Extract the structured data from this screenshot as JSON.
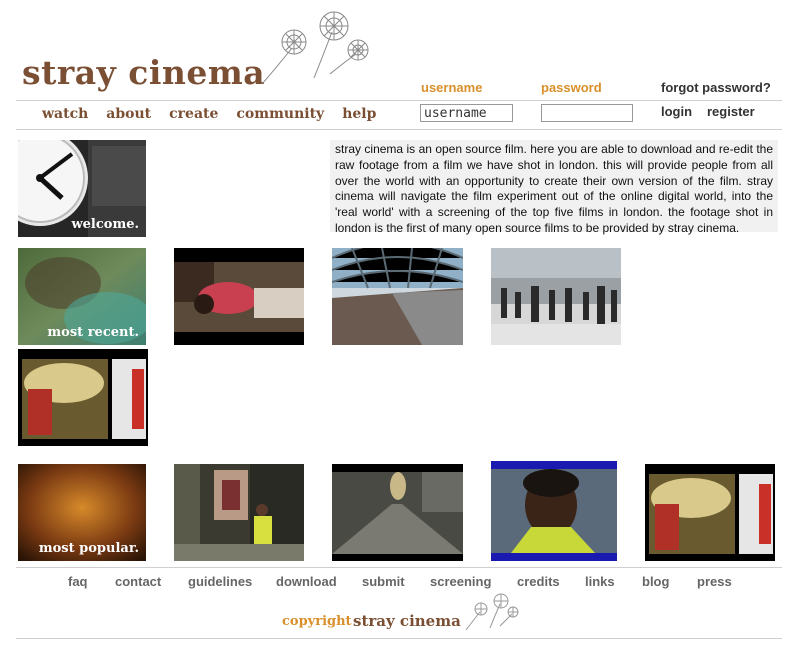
{
  "brand": {
    "name": "stray cinema"
  },
  "nav": {
    "items": [
      {
        "label": "watch"
      },
      {
        "label": "about"
      },
      {
        "label": "create"
      },
      {
        "label": "community"
      },
      {
        "label": "help"
      }
    ]
  },
  "auth": {
    "username_label": "username",
    "password_label": "password",
    "forgot_label": "forgot password?",
    "username_value": "username",
    "password_value": "",
    "login_label": "login",
    "register_label": "register"
  },
  "intro": {
    "text": "stray cinema is an open source film. here you are able to download and re-edit the raw footage from a film we have shot in london. this will provide people from all over the world with an opportunity to create their own version of the film. stray cinema will navigate the film experiment out of the online digital world, into the 'real world' with a screening of the top five films in london. the footage shot in london is the first of many open source films to be provided by stray cinema."
  },
  "sections": {
    "welcome_label": "welcome.",
    "recent_label": "most recent.",
    "popular_label": "most popular."
  },
  "footer": {
    "links": [
      {
        "label": "faq"
      },
      {
        "label": "contact"
      },
      {
        "label": "guidelines"
      },
      {
        "label": "download"
      },
      {
        "label": "submit"
      },
      {
        "label": "screening"
      },
      {
        "label": "credits"
      },
      {
        "label": "links"
      },
      {
        "label": "blog"
      },
      {
        "label": "press"
      }
    ],
    "copyright_label": "copyright",
    "copyright_brand": "stray cinema"
  },
  "colors": {
    "brand_brown": "#7a4f33",
    "accent_orange": "#d9902a",
    "intro_bg": "#f1f1f1",
    "footer_link": "#666666"
  },
  "icons": {
    "logo_decoration": "dandelion-flowers-icon"
  }
}
